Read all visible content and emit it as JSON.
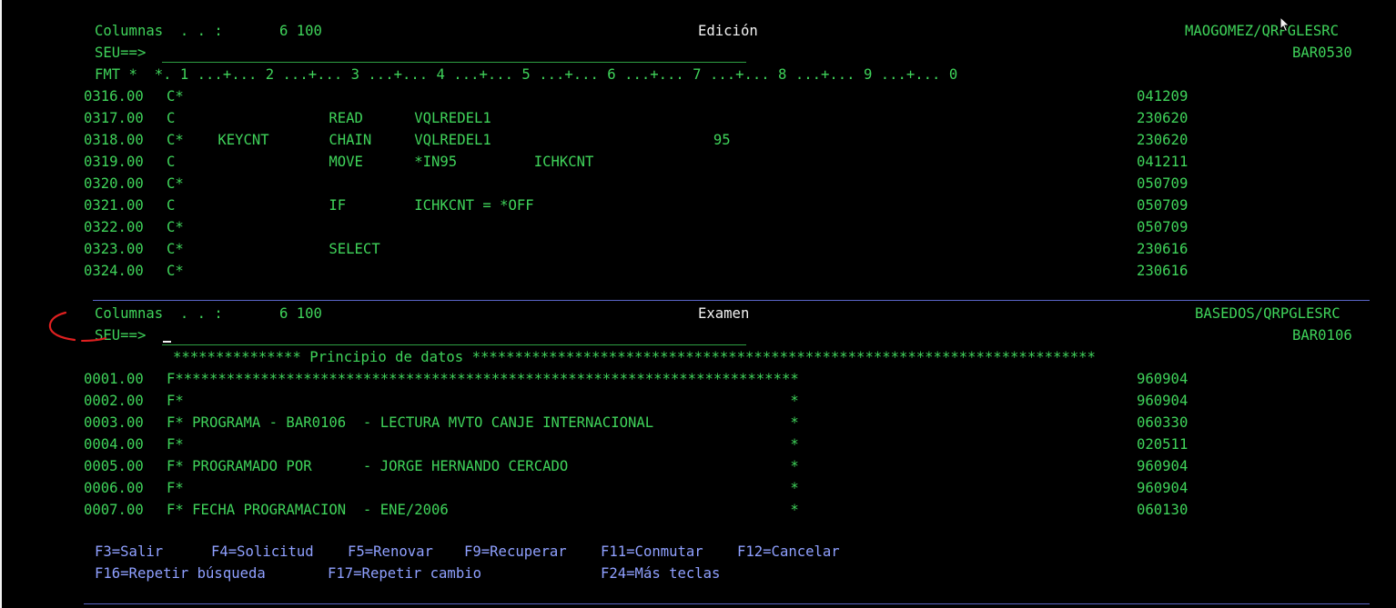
{
  "top": {
    "columns_label": "Columnas  . . :",
    "columns_value": "6 100",
    "mode_title": "Edición",
    "source_file": "MAOGOMEZ/QRPGLESRC",
    "member": "BAR0530",
    "seu_prompt": "SEU==>",
    "fmt_ruler": "FMT *  *. 1 ...+... 2 ...+... 3 ...+... 4 ...+... 5 ...+... 6 ...+... 7 ...+... 8 ...+... 9 ...+... 0",
    "lines": [
      {
        "seq": "0316.00",
        "code": "C*",
        "date": "041209"
      },
      {
        "seq": "0317.00",
        "code": "C                  READ      VQLREDEL1",
        "date": "230620"
      },
      {
        "seq": "0318.00",
        "code": "C*    KEYCNT       CHAIN     VQLREDEL1                          95",
        "date": "230620"
      },
      {
        "seq": "0319.00",
        "code": "C                  MOVE      *IN95         ICHKCNT",
        "date": "041211"
      },
      {
        "seq": "0320.00",
        "code": "C*",
        "date": "050709"
      },
      {
        "seq": "0321.00",
        "code": "C                  IF        ICHKCNT = *OFF",
        "date": "050709"
      },
      {
        "seq": "0322.00",
        "code": "C*",
        "date": "050709"
      },
      {
        "seq": "0323.00",
        "code": "C*                 SELECT",
        "date": "230616"
      },
      {
        "seq": "0324.00",
        "code": "C*",
        "date": "230616"
      }
    ]
  },
  "bottom": {
    "columns_label": "Columnas  . . :",
    "columns_value": "6 100",
    "mode_title": "Examen",
    "source_file": "BASEDOS/QRPGLESRC",
    "member": "BAR0106",
    "seu_prompt": "SEU==>",
    "data_start": "*************** Principio de datos *************************************************************************",
    "lines": [
      {
        "seq": "0001.00",
        "code": "F*************************************************************************",
        "date": "960904"
      },
      {
        "seq": "0002.00",
        "code": "F*                                                                       *",
        "date": "960904"
      },
      {
        "seq": "0003.00",
        "code": "F* PROGRAMA - BAR0106  - LECTURA MVTO CANJE INTERNACIONAL                *",
        "date": "060330"
      },
      {
        "seq": "0004.00",
        "code": "F*                                                                       *",
        "date": "020511"
      },
      {
        "seq": "0005.00",
        "code": "F* PROGRAMADO POR      - JORGE HERNANDO CERCADO                          *",
        "date": "960904"
      },
      {
        "seq": "0006.00",
        "code": "F*                                                                       *",
        "date": "960904"
      },
      {
        "seq": "0007.00",
        "code": "F* FECHA PROGRAMACION  - ENE/2006                                        *",
        "date": "060130"
      }
    ]
  },
  "function_keys": {
    "row1": [
      {
        "key": "F3=Salir"
      },
      {
        "key": "F4=Solicitud"
      },
      {
        "key": "F5=Renovar"
      },
      {
        "key": "F9=Recuperar"
      },
      {
        "key": "F11=Conmutar"
      },
      {
        "key": "F12=Cancelar"
      }
    ],
    "row2": [
      {
        "key": "F16=Repetir búsqueda"
      },
      {
        "key": "F17=Repetir cambio"
      },
      {
        "key": "F24=Más teclas"
      }
    ]
  },
  "colors": {
    "background": "#000000",
    "text_green": "#3fd35a",
    "text_white": "#f2f2f2",
    "text_blue": "#8fa0ff",
    "separator_blue": "#5b66c9",
    "annotation_red": "#e02020"
  }
}
